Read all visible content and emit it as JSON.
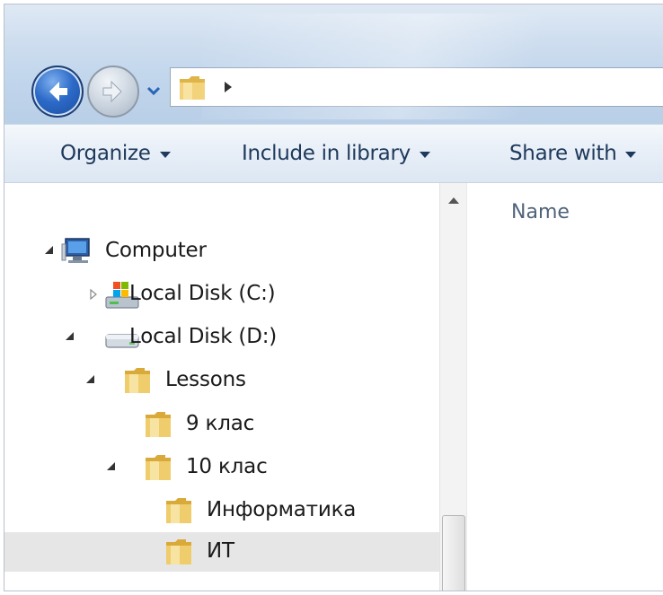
{
  "address": {
    "path_segments": []
  },
  "toolbar": {
    "organize": "Organize",
    "include_in_library": "Include in library",
    "share_with": "Share with"
  },
  "navigation_tree": [
    {
      "label": "Computer",
      "level": 0,
      "expanded": true,
      "icon": "computer-icon",
      "selected": false
    },
    {
      "label": "Local Disk (C:)",
      "level": 1,
      "expanded": false,
      "icon": "windows-drive-icon",
      "selected": false
    },
    {
      "label": "Local Disk (D:)",
      "level": 1,
      "expanded": true,
      "icon": "hard-drive-icon",
      "selected": false
    },
    {
      "label": "Lessons",
      "level": 2,
      "expanded": true,
      "icon": "folder-icon",
      "selected": false
    },
    {
      "label": "9 клас",
      "level": 3,
      "expanded": null,
      "icon": "folder-icon",
      "selected": false
    },
    {
      "label": "10 клас",
      "level": 3,
      "expanded": true,
      "icon": "folder-icon",
      "selected": false
    },
    {
      "label": "Информатика",
      "level": 4,
      "expanded": null,
      "icon": "folder-icon",
      "selected": false
    },
    {
      "label": "ИТ",
      "level": 4,
      "expanded": null,
      "icon": "folder-icon",
      "selected": true
    }
  ],
  "content": {
    "columns": [
      "Name"
    ]
  },
  "colors": {
    "toolbar_text": "#1e395b",
    "selection": "#e6e6e6",
    "folder": "#e9c25a"
  }
}
